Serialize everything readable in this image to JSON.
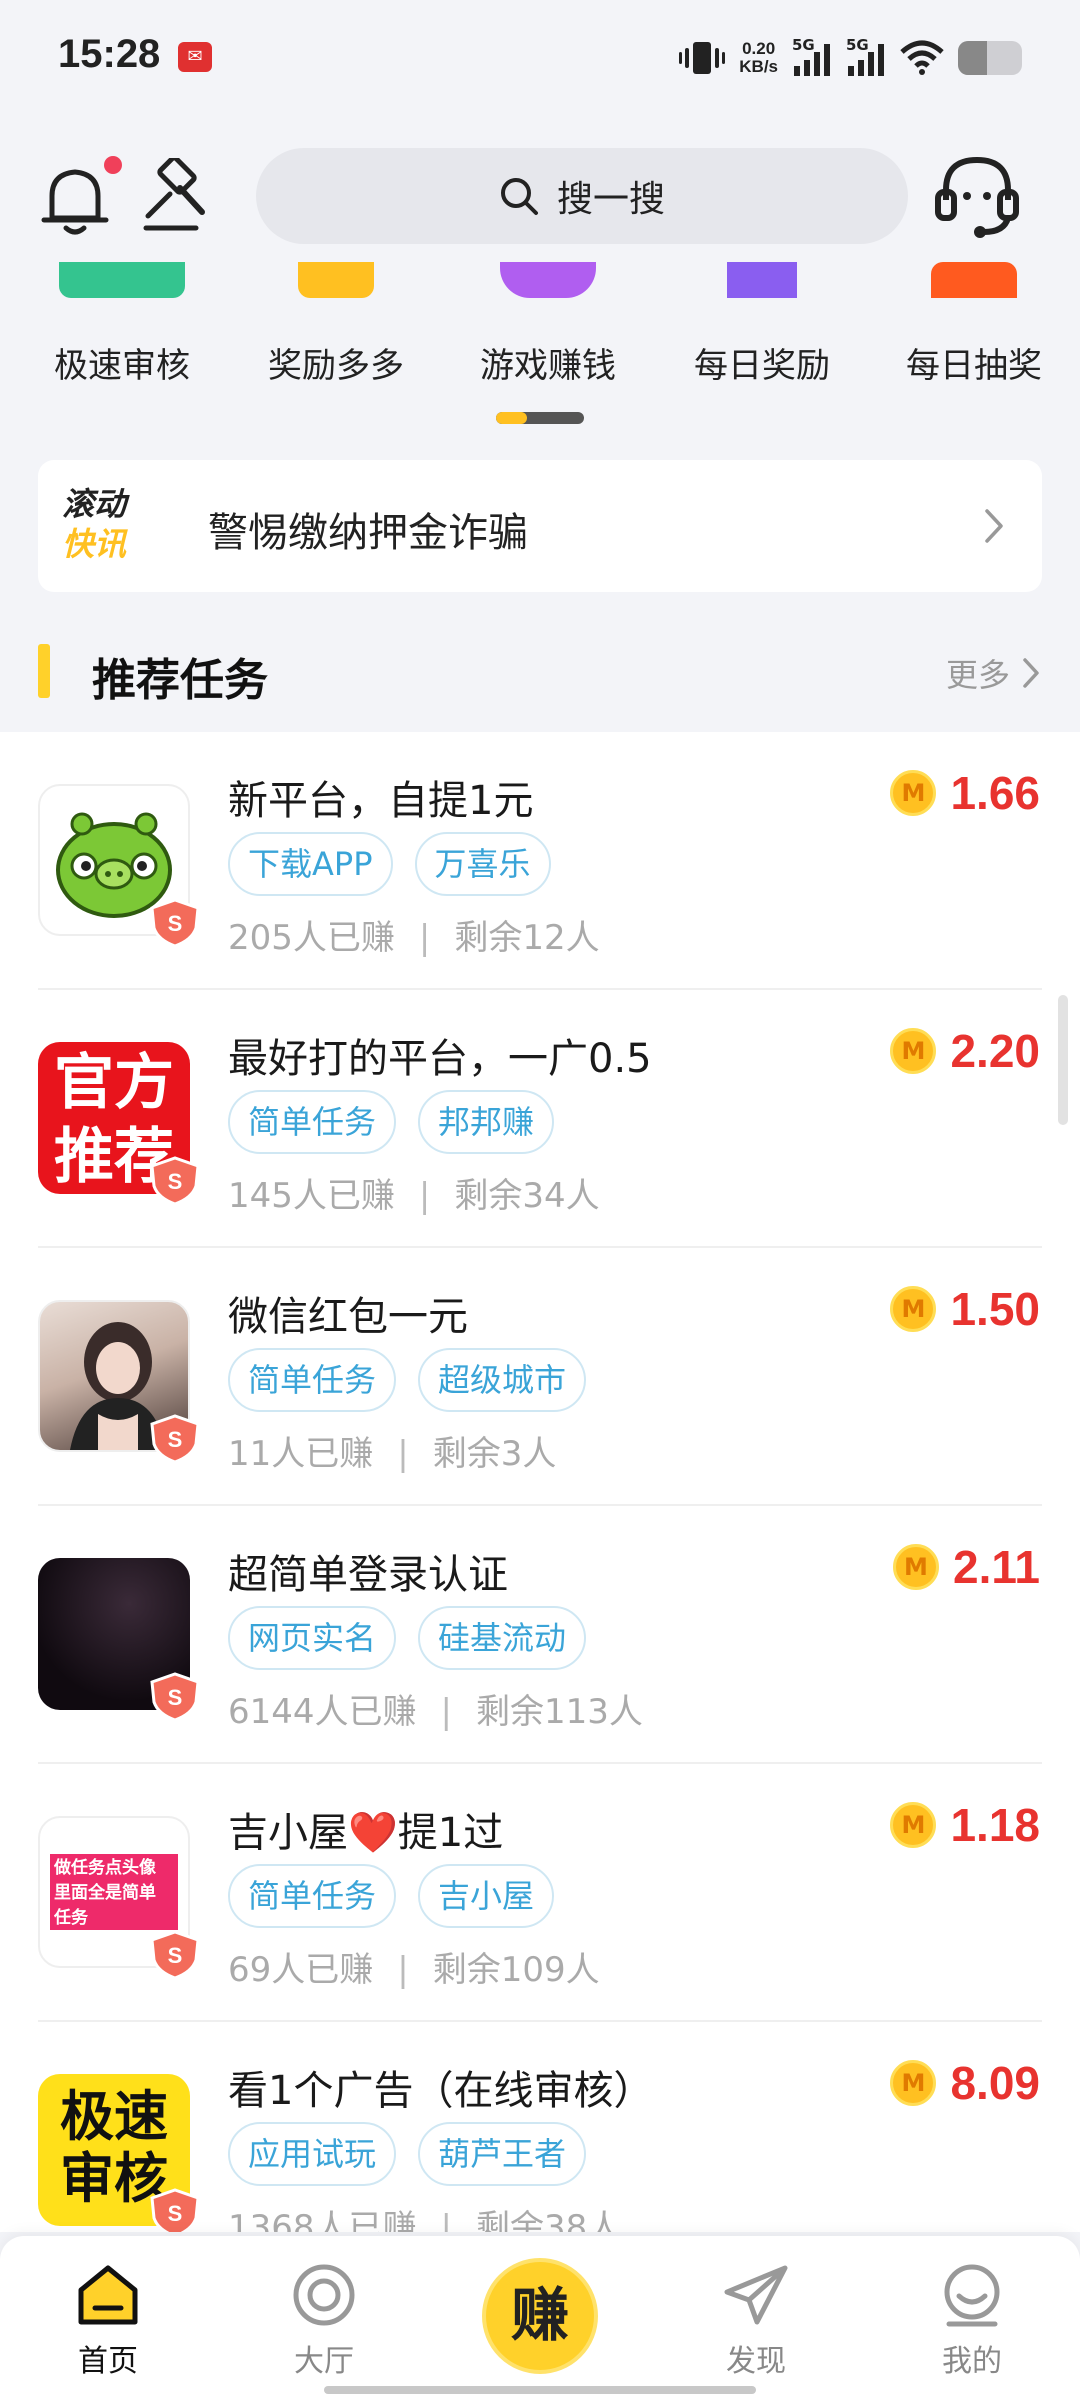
{
  "status": {
    "time": "15:28",
    "app_icon": "mail-app-icon",
    "net_speed_value": "0.20",
    "net_speed_unit": "KB/s",
    "sim1": "5G",
    "sim2": "5G",
    "battery_level": 0.45
  },
  "header": {
    "search_placeholder": "搜一搜",
    "icons": [
      "bell-icon",
      "hammer-icon",
      "search-icon",
      "headset-icon"
    ]
  },
  "categories": {
    "items": [
      {
        "label": "极速审核",
        "color": "#34c48f"
      },
      {
        "label": "奖励多多",
        "color": "#ffc021"
      },
      {
        "label": "游戏赚钱",
        "color": "#b05ef0"
      },
      {
        "label": "每日奖励",
        "color": "#8a5ef0"
      },
      {
        "label": "每日抽奖",
        "color": "#ff5a1f"
      }
    ],
    "scroll_progress": 0.35
  },
  "news": {
    "badge_line1": "滚动",
    "badge_line2": "快讯",
    "text": "警惕缴纳押金诈骗"
  },
  "section": {
    "title": "推荐任务",
    "more": "更多"
  },
  "tasks": [
    {
      "title": "新平台，自提1元",
      "tags": [
        "下载APP",
        "万喜乐"
      ],
      "earned": "205人已赚",
      "remain": "剩余12人",
      "price": "1.66"
    },
    {
      "title": "最好打的平台，一广0.5",
      "tags": [
        "简单任务",
        "邦邦赚"
      ],
      "earned": "145人已赚",
      "remain": "剩余34人",
      "price": "2.20",
      "thumb_text": [
        "官方",
        "推荐"
      ]
    },
    {
      "title": "微信红包一元",
      "tags": [
        "简单任务",
        "超级城市"
      ],
      "earned": "11人已赚",
      "remain": "剩余3人",
      "price": "1.50"
    },
    {
      "title": "超简单登录认证",
      "tags": [
        "网页实名",
        "硅基流动"
      ],
      "earned": "6144人已赚",
      "remain": "剩余113人",
      "price": "2.11"
    },
    {
      "title": "吉小屋❤️提1过",
      "tags": [
        "简单任务",
        "吉小屋"
      ],
      "earned": "69人已赚",
      "remain": "剩余109人",
      "price": "1.18",
      "thumb_text": [
        "做任务点头像",
        "里面全是简单",
        "任务"
      ]
    },
    {
      "title": "看1个广告（在线审核）",
      "tags": [
        "应用试玩",
        "葫芦王者"
      ],
      "earned": "1368人已赚",
      "remain": "剩余38人",
      "price": "8.09",
      "thumb_text": [
        "极速",
        "审核"
      ]
    }
  ],
  "coin_letter": "M",
  "shield_letter": "S",
  "nav": {
    "home": "首页",
    "hall": "大厅",
    "earn": "赚",
    "discover": "发现",
    "mine": "我的"
  }
}
